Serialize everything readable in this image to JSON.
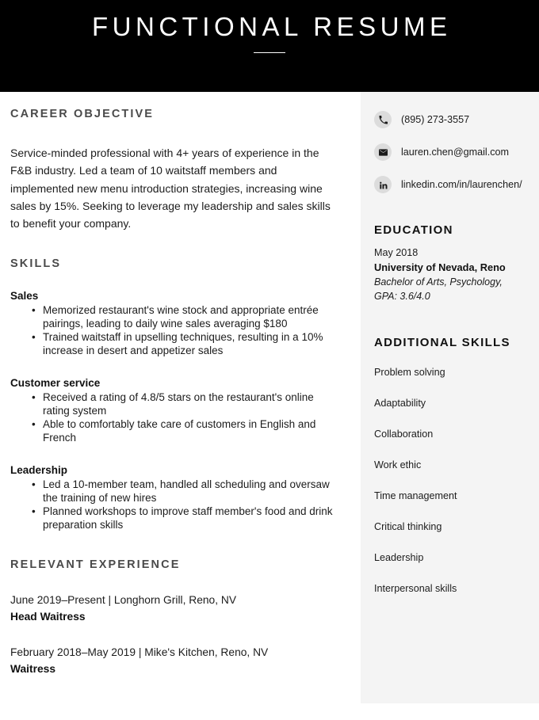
{
  "header": {
    "title": "FUNCTIONAL RESUME"
  },
  "main": {
    "objective": {
      "heading": "CAREER OBJECTIVE",
      "text": "Service-minded professional with 4+ years of experience in the F&B industry. Led a team of 10 waitstaff members and implemented new menu introduction strategies, increasing wine sales by 15%. Seeking to leverage my leadership and sales skills to benefit your company."
    },
    "skills": {
      "heading": "SKILLS",
      "groups": [
        {
          "name": "Sales",
          "items": [
            "Memorized restaurant's wine stock and appropriate entrée pairings, leading to daily wine sales averaging $180",
            "Trained waitstaff in upselling techniques, resulting in a 10% increase in desert and appetizer sales"
          ]
        },
        {
          "name": "Customer service",
          "items": [
            "Received a rating of 4.8/5 stars on the restaurant's online rating system",
            "Able to comfortably take care of customers in English and French"
          ]
        },
        {
          "name": "Leadership",
          "items": [
            "Led a 10-member team, handled all scheduling and oversaw the training of new hires",
            "Planned workshops to improve staff member's food and drink preparation skills"
          ]
        }
      ]
    },
    "experience": {
      "heading": "RELEVANT EXPERIENCE",
      "items": [
        {
          "meta": "June 2019–Present | Longhorn Grill, Reno, NV",
          "title": "Head Waitress"
        },
        {
          "meta": "February 2018–May 2019 | Mike's Kitchen, Reno, NV",
          "title": "Waitress"
        }
      ]
    }
  },
  "sidebar": {
    "contact": [
      {
        "icon": "phone-icon",
        "value": "(895) 273-3557"
      },
      {
        "icon": "email-icon",
        "value": "lauren.chen@gmail.com"
      },
      {
        "icon": "linkedin-icon",
        "value": "linkedin.com/in/laurenchen/"
      }
    ],
    "education": {
      "heading": "EDUCATION",
      "date": "May 2018",
      "school": "University of Nevada, Reno",
      "degree_line1": "Bachelor of Arts, Psychology,",
      "degree_line2": "GPA: 3.6/4.0"
    },
    "additional_skills": {
      "heading": "ADDITIONAL SKILLS",
      "items": [
        "Problem solving",
        "Adaptability",
        "Collaboration",
        "Work ethic",
        "Time management",
        "Critical thinking",
        "Leadership",
        "Interpersonal skills"
      ]
    }
  },
  "colors": {
    "banner_background": "#000000",
    "banner_text": "#ffffff",
    "sidebar_background": "#f4f4f4",
    "heading_gray": "#4a4a4a",
    "body_text": "#1c1c1c",
    "icon_badge": "#dcdcdc"
  }
}
